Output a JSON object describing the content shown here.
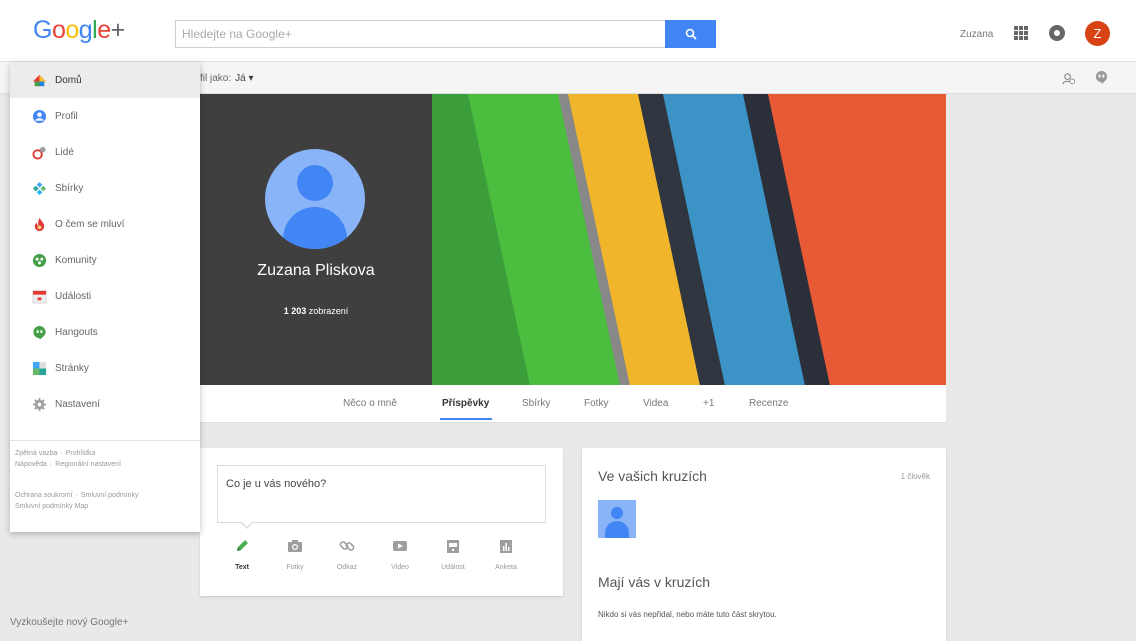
{
  "logo": {
    "g1": "G",
    "g2": "o",
    "g3": "o",
    "g4": "g",
    "g5": "l",
    "g6": "e",
    "plus": "+"
  },
  "search": {
    "placeholder": "Hledejte na Google+",
    "button_icon": "search-icon"
  },
  "user": {
    "name": "Zuzana",
    "avatar_letter": "Z",
    "avatar_color": "#d84315"
  },
  "subbar": {
    "view_as_label": "fil jako:",
    "view_as_value": "Já ▾"
  },
  "profile": {
    "name": "Zuzana Pliskova",
    "views_count": "1 203",
    "views_label": "zobrazení"
  },
  "tabs": [
    {
      "label": "Něco o mně"
    },
    {
      "label": "Příspěvky"
    },
    {
      "label": "Sbírky"
    },
    {
      "label": "Fotky"
    },
    {
      "label": "Videa"
    },
    {
      "label": "+1"
    },
    {
      "label": "Recenze"
    }
  ],
  "drawer": {
    "items": [
      {
        "label": "Domů",
        "icon": "home-icon"
      },
      {
        "label": "Profil",
        "icon": "profile-icon"
      },
      {
        "label": "Lidé",
        "icon": "people-icon"
      },
      {
        "label": "Sbírky",
        "icon": "collections-icon"
      },
      {
        "label": "O čem se mluví",
        "icon": "trending-icon"
      },
      {
        "label": "Komunity",
        "icon": "communities-icon"
      },
      {
        "label": "Události",
        "icon": "events-icon"
      },
      {
        "label": "Hangouts",
        "icon": "hangouts-icon"
      },
      {
        "label": "Stránky",
        "icon": "pages-icon"
      },
      {
        "label": "Nastavení",
        "icon": "settings-icon"
      }
    ],
    "links": {
      "feedback": "Zpětná vazba",
      "privacy": "Prohlídka",
      "help": "Nápověda",
      "regional": "Regionální nastavení",
      "privacy_policy": "Ochrana soukromí",
      "terms": "Smluvní podmínky",
      "terms2": "Smluvní podmínky Map"
    }
  },
  "try_new": "Vyzkoušejte nový Google+",
  "composer": {
    "prompt": "Co je u vás nového?",
    "types": [
      {
        "label": "Text",
        "icon": "pencil-icon"
      },
      {
        "label": "Fotky",
        "icon": "camera-icon"
      },
      {
        "label": "Odkaz",
        "icon": "link-icon"
      },
      {
        "label": "Video",
        "icon": "video-icon"
      },
      {
        "label": "Událost",
        "icon": "event-icon"
      },
      {
        "label": "Anketa",
        "icon": "poll-icon"
      }
    ]
  },
  "circles": {
    "in_your_circles": "Ve vašich kruzích",
    "count": "1 člověk",
    "have_you": "Mají vás v kruzích",
    "note": "Nikdo si vás nepřidal, nebo máte tuto část skrytou."
  },
  "colors": {
    "accent": "#4285f4",
    "cover_dark": "#3f3f3f",
    "active_tab_underline": "#4285f4"
  }
}
